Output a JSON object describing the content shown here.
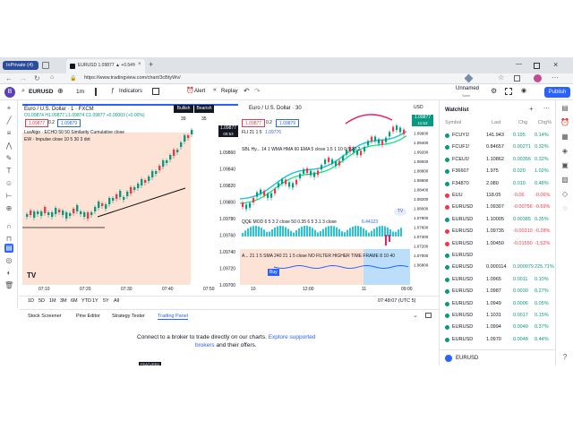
{
  "browser": {
    "profile": "InPrivate (4)",
    "tab_title": "EURUSD 1.09877 ▲ +0.54% Unn",
    "url": "https://www.tradingview.com/chart/3cBtyWv/"
  },
  "toolbar": {
    "symbol": "EURUSD",
    "interval": "1m",
    "indicators": "Indicators",
    "alert": "Alert",
    "replay": "Replay",
    "layout_name": "Unnamed",
    "layout_sub": "Save",
    "publish": "Publish"
  },
  "left_chart": {
    "title": "Euro / U.S. Dollar · 1 · FXCM",
    "ohlc": "O1.09874 H1.09877 L1.09874 C1.09877 +0.00003 (+0.00%)",
    "sell_price": "1.09877",
    "spread": "0.2",
    "buy_price": "1.09879",
    "indicator1": "LuxAlgo · ECHO 50 50 Similarity Cumulative close",
    "indicator2": "EW - Impulse close 10 5 30 3 dot",
    "bullish": "Bullish",
    "bearish": "Bearish",
    "bull_count": "39",
    "bear_count": "35",
    "last_price": "1.09877",
    "last_time": "00:53",
    "price_ticks": [
      "1.09860",
      "1.09840",
      "1.09820",
      "1.09800",
      "1.09780",
      "1.09760",
      "1.09740",
      "1.09720",
      "1.09700"
    ],
    "time_ticks": [
      "07:10",
      "07:20",
      "07:30",
      "07:40",
      "07:50"
    ],
    "badge": "TV"
  },
  "right_chart": {
    "title": "Euro / U.S. Dollar · 30",
    "sell_price": "1.09877",
    "spread": "0.2",
    "buy_price": "1.09879",
    "ind1": "FLI 21 1 5",
    "ind1_val": "1.09776",
    "ind2": "SBL Hy... 14 1 WMA HMA 60 EMA 5 close 1.5 1 10 0.5 20 2",
    "ind3": "QQE MOD 6 5 3 2 close 50 0.35 6 5 3.1 3 close",
    "ind3_val": "6.44123",
    "ind4": "A... 21 1 5 SMA 240 21 1 5 close NO FILTER HIGHER TIME FRAME 8 10 40",
    "buy_tag": "Buy",
    "currency": "USD",
    "last_price": "1.09877",
    "last_time": "11:53",
    "price_ticks": [
      "1.09800",
      "1.09600",
      "1.09400",
      "1.09200",
      "1.09000",
      "1.08800",
      "1.08600",
      "1.08400",
      "1.08200",
      "1.08000",
      "1.07800",
      "1.07600",
      "1.07400",
      "1.07200",
      "1.07000",
      "1.06800"
    ],
    "time_ticks": [
      "10",
      "12:00",
      "11",
      "09:00"
    ],
    "clock": "07:48:07 (UTC 5)",
    "logo": "TV"
  },
  "range_bar": [
    "1D",
    "5D",
    "1M",
    "3M",
    "6M",
    "YTD",
    "1Y",
    "5Y",
    "All"
  ],
  "bottom_panel": {
    "tabs": [
      "Stock Screener",
      "Pine Editor",
      "Strategy Tester",
      "Trading Panel"
    ],
    "connect_text": "Connect to a broker to trade directly on our charts.",
    "explore_link": "Explore supported",
    "brokers_link": "brokers",
    "tail": "and their offers.",
    "featured": "FEATURED"
  },
  "watchlist": {
    "title": "Watchlist",
    "headers": [
      "Symbol",
      "Last",
      "Chg",
      "Chg%"
    ],
    "rows": [
      {
        "symbol": "FCUY1!",
        "last": "141.943",
        "chg": "0.195",
        "pct": "0.14%",
        "color": "#089981"
      },
      {
        "symbol": "FCUF1!",
        "last": "0.84657",
        "chg": "0.00271",
        "pct": "0.32%",
        "color": "#089981"
      },
      {
        "symbol": "FCEU1!",
        "last": "1.10862",
        "chg": "0.00356",
        "pct": "0.32%",
        "color": "#089981"
      },
      {
        "symbol": "F36607",
        "last": "1.975",
        "chg": "0.020",
        "pct": "1.02%",
        "color": "#089981"
      },
      {
        "symbol": "F34870",
        "last": "2.080",
        "chg": "0.010",
        "pct": "0.48%",
        "color": "#089981"
      },
      {
        "symbol": "EUU",
        "last": "118.05",
        "chg": "-0.06",
        "pct": "-0.06%",
        "color": "#f23645"
      },
      {
        "symbol": "EURUSD",
        "last": "1.09307",
        "chg": "-0.00756",
        "pct": "-0.69%",
        "color": "#f23645"
      },
      {
        "symbol": "EURUSD",
        "last": "1.10005",
        "chg": "0.00385",
        "pct": "0.35%",
        "color": "#089981"
      },
      {
        "symbol": "EURUSD",
        "last": "1.09735",
        "chg": "-0.00310",
        "pct": "-0.28%",
        "color": "#f23645"
      },
      {
        "symbol": "EURUSD",
        "last": "1.00450",
        "chg": "-0.01550",
        "pct": "-1.52%",
        "color": "#f23645"
      },
      {
        "symbol": "EURUSD",
        "last": "",
        "chg": "",
        "pct": "",
        "color": "#089981"
      },
      {
        "symbol": "EURUSD",
        "last": "0.000114",
        "chg": "0.000079",
        "pct": "225.71%",
        "color": "#089981"
      },
      {
        "symbol": "EURUSD",
        "last": "1.0965",
        "chg": "0.0011",
        "pct": "0.10%",
        "color": "#089981"
      },
      {
        "symbol": "EURUSD",
        "last": "1.0987",
        "chg": "0.0030",
        "pct": "0.27%",
        "color": "#089981"
      },
      {
        "symbol": "EURUSD",
        "last": "1.0949",
        "chg": "0.0006",
        "pct": "0.05%",
        "color": "#089981"
      },
      {
        "symbol": "EURUSD",
        "last": "1.1031",
        "chg": "0.0017",
        "pct": "0.15%",
        "color": "#089981"
      },
      {
        "symbol": "EURUSD",
        "last": "1.0994",
        "chg": "0.0040",
        "pct": "0.37%",
        "color": "#089981"
      },
      {
        "symbol": "EURUSD",
        "last": "1.0970",
        "chg": "0.0048",
        "pct": "0.44%",
        "color": "#089981"
      }
    ],
    "footer_symbol": "EURUSD"
  },
  "colors": {
    "accent": "#2962ff",
    "up": "#089981",
    "down": "#f23645",
    "left_bg": "#fde3d6",
    "sell": "#f23645",
    "buy": "#2962ff"
  }
}
